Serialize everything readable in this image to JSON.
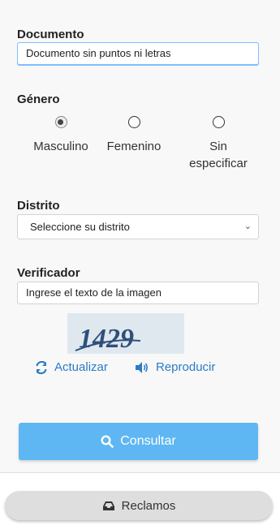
{
  "documento": {
    "label": "Documento",
    "value": "Documento sin puntos ni letras"
  },
  "genero": {
    "label": "Género",
    "options": [
      {
        "label": "Masculino",
        "selected": true
      },
      {
        "label": "Femenino",
        "selected": false
      },
      {
        "label": "Sin especificar",
        "selected": false
      }
    ]
  },
  "distrito": {
    "label": "Distrito",
    "selected": "Seleccione su distrito"
  },
  "verificador": {
    "label": "Verificador",
    "placeholder": "Ingrese el texto de la imagen",
    "captcha_text": "1429",
    "refresh_label": "Actualizar",
    "play_label": "Reproducir"
  },
  "actions": {
    "consultar_label": "Consultar",
    "reclamos_label": "Reclamos"
  },
  "colors": {
    "accent": "#5eb7f2",
    "link": "#2b7cc7"
  }
}
